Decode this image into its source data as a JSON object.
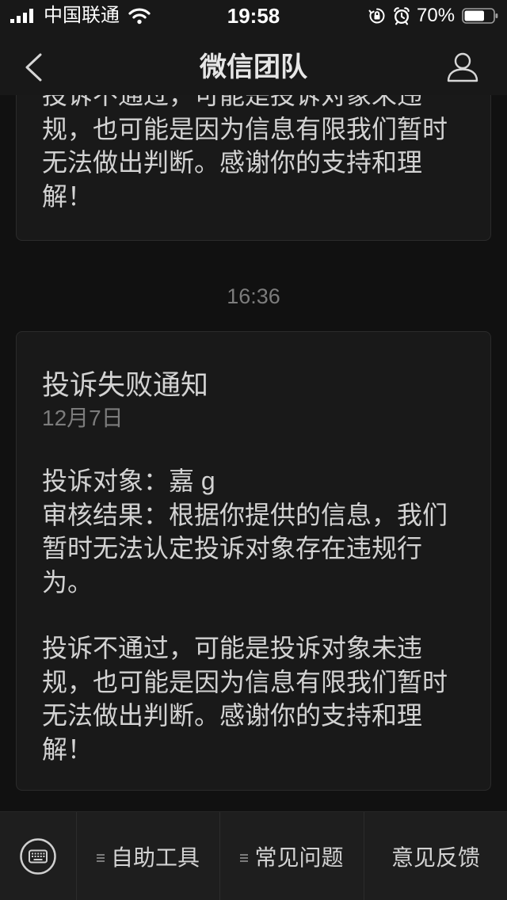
{
  "status_bar": {
    "carrier": "中国联通",
    "time": "19:58",
    "battery_text": "70%",
    "battery_level": 0.7,
    "icons": [
      "signal-icon",
      "wifi-icon",
      "orientation-lock-icon",
      "alarm-icon",
      "battery-icon"
    ]
  },
  "nav": {
    "title": "微信团队",
    "left_icon": "chevron-left-icon",
    "right_icon": "person-icon"
  },
  "feed": {
    "previous_card": {
      "lines": [
        "投诉不通过，可能是投诉对象未违",
        "规，也可能是因为信息有限我们暂时",
        "无法做出判断。感谢你的支持和理",
        "解！"
      ]
    },
    "timestamp": "16:36",
    "notice_card": {
      "title": "投诉失败通知",
      "date": "12月7日",
      "detail_lines": [
        "投诉对象：嘉 g",
        "审核结果：根据你提供的信息，我们",
        "暂时无法认定投诉对象存在违规行",
        "为。"
      ],
      "note_lines": [
        "投诉不通过，可能是投诉对象未违",
        "规，也可能是因为信息有限我们暂时",
        "无法做出判断。感谢你的支持和理",
        "解！"
      ]
    }
  },
  "bottom_menu": {
    "keyboard_icon": "keyboard-icon",
    "items": [
      {
        "label": "自助工具",
        "icon": "submenu-list-icon"
      },
      {
        "label": "常见问题",
        "icon": "submenu-list-icon"
      },
      {
        "label": "意见反馈"
      }
    ]
  },
  "theme": {
    "background": "#111111",
    "bar": "#181818",
    "card": "#191919",
    "card_border": "#2b2b2b",
    "text": "#d3d3d3",
    "muted": "#7c7c7c",
    "menu": "#1e1e1e"
  }
}
